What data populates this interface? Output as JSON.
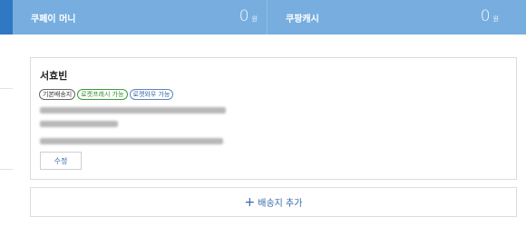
{
  "wallet": {
    "coupay_money": {
      "label": "쿠페이 머니",
      "amount": "0",
      "unit": "원"
    },
    "coupang_cash": {
      "label": "쿠팡캐시",
      "amount": "0",
      "unit": "원"
    }
  },
  "address": {
    "name": "서효빈",
    "badges": [
      "기본배송지",
      "로켓프레시 가능",
      "로켓와우 가능"
    ],
    "edit_label": "수정"
  },
  "add_address": {
    "label": "배송지 추가",
    "icon": "plus-icon"
  },
  "colors": {
    "header_bg": "#77aedf",
    "accent_blue": "#346aa8",
    "badge_green": "#2f8a2f"
  }
}
